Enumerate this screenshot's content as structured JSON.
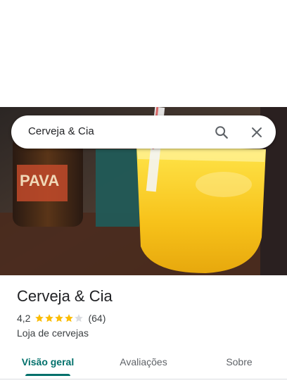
{
  "search": {
    "query": "Cerveja & Cia",
    "search_icon": "search-icon",
    "close_icon": "close-icon"
  },
  "place": {
    "name": "Cerveja & Cia",
    "rating": "4,2",
    "rating_value": 4.2,
    "stars_max": 5,
    "review_count": "(64)",
    "category": "Loja de cervejas"
  },
  "hero_photo": {
    "bottle_label": "PAVA"
  },
  "tabs": [
    {
      "label": "Visão geral",
      "active": true
    },
    {
      "label": "Avaliações",
      "active": false
    },
    {
      "label": "Sobre",
      "active": false
    }
  ],
  "colors": {
    "accent": "#01706b",
    "star": "#fbbc04",
    "star_empty": "#dadce0"
  }
}
